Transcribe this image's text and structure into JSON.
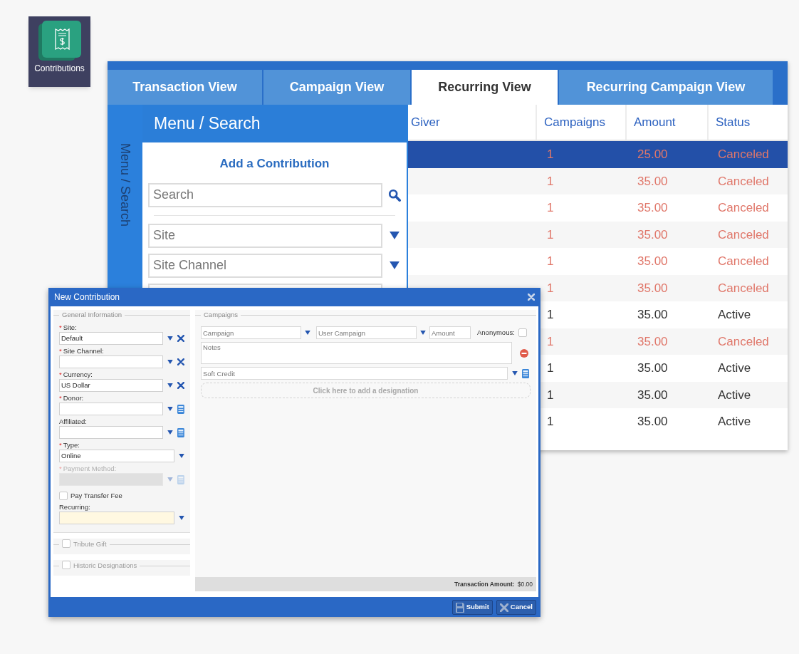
{
  "app_tile": {
    "label": "Contributions"
  },
  "main_window": {
    "tabs": [
      {
        "label": "Transaction View",
        "selected": false
      },
      {
        "label": "Campaign View",
        "selected": false
      },
      {
        "label": "Recurring View",
        "selected": true
      },
      {
        "label": "Recurring Campaign View",
        "selected": false
      }
    ],
    "side_rail": {
      "label": "Menu / Search"
    },
    "panel": {
      "title": "Menu / Search",
      "heading": "Add a Contribution",
      "search": {
        "placeholder": "Search"
      },
      "filters": [
        {
          "placeholder": "Site"
        },
        {
          "placeholder": "Site Channel"
        }
      ]
    },
    "table": {
      "columns": [
        "Giver",
        "Campaigns",
        "Amount",
        "Status"
      ],
      "rows": [
        {
          "campaigns": "1",
          "amount": "25.00",
          "status": "Canceled",
          "kind": "canceled",
          "selected": true
        },
        {
          "campaigns": "1",
          "amount": "35.00",
          "status": "Canceled",
          "kind": "canceled",
          "selected": false
        },
        {
          "campaigns": "1",
          "amount": "35.00",
          "status": "Canceled",
          "kind": "canceled",
          "selected": false
        },
        {
          "campaigns": "1",
          "amount": "35.00",
          "status": "Canceled",
          "kind": "canceled",
          "selected": false
        },
        {
          "campaigns": "1",
          "amount": "35.00",
          "status": "Canceled",
          "kind": "canceled",
          "selected": false
        },
        {
          "campaigns": "1",
          "amount": "35.00",
          "status": "Canceled",
          "kind": "canceled",
          "selected": false
        },
        {
          "campaigns": "1",
          "amount": "35.00",
          "status": "Active",
          "kind": "active",
          "selected": false
        },
        {
          "campaigns": "1",
          "amount": "35.00",
          "status": "Canceled",
          "kind": "canceled",
          "selected": false
        },
        {
          "campaigns": "1",
          "amount": "35.00",
          "status": "Active",
          "kind": "active",
          "selected": false
        },
        {
          "campaigns": "1",
          "amount": "35.00",
          "status": "Active",
          "kind": "active",
          "selected": false
        },
        {
          "campaigns": "1",
          "amount": "35.00",
          "status": "Active",
          "kind": "active",
          "selected": false
        }
      ]
    }
  },
  "dialog": {
    "title": "New Contribution",
    "general": {
      "legend": "General Information",
      "fields": [
        {
          "kind": "select",
          "required_mark": "*",
          "label": "Site:",
          "value": "Default",
          "clearable": true,
          "lookup": false,
          "disabled": false,
          "highlighted": false
        },
        {
          "kind": "select",
          "required_mark": "*",
          "label": "Site Channel:",
          "clearable": true,
          "lookup": false,
          "disabled": false,
          "highlighted": false
        },
        {
          "kind": "select",
          "required_mark": "*",
          "label": "Currency:",
          "value": "US Dollar",
          "clearable": true,
          "lookup": false,
          "disabled": false,
          "highlighted": false
        },
        {
          "kind": "select",
          "required_mark": "*",
          "label": "Donor:",
          "clearable": false,
          "lookup": true,
          "disabled": false,
          "highlighted": false
        },
        {
          "kind": "select",
          "label": "Affiliated:",
          "clearable": false,
          "lookup": true,
          "disabled": false,
          "highlighted": false
        },
        {
          "kind": "select",
          "required_mark": "*",
          "label": "Type:",
          "value": "Online",
          "clearable": false,
          "lookup": false,
          "disabled": false,
          "highlighted": false
        },
        {
          "kind": "select",
          "required_mark": "*",
          "label": "Payment Method:",
          "clearable": false,
          "lookup": true,
          "disabled": true,
          "highlighted": false
        },
        {
          "kind": "checkbox",
          "label": "Pay Transfer Fee",
          "checked": false
        },
        {
          "kind": "select",
          "label": "Recurring:",
          "clearable": false,
          "lookup": false,
          "disabled": false,
          "highlighted": true
        }
      ]
    },
    "sections": [
      {
        "label": "Tribute Gift",
        "checked": false
      },
      {
        "label": "Historic Designations",
        "checked": false
      }
    ],
    "campaigns": {
      "legend": "Campaigns",
      "campaign": {
        "placeholder": "Campaign"
      },
      "user_campaign": {
        "placeholder": "User Campaign"
      },
      "amount": {
        "placeholder": "Amount"
      },
      "anonymous": {
        "label": "Anonymous:",
        "checked": false
      },
      "notes": {
        "placeholder": "Notes"
      },
      "soft_credit": {
        "placeholder": "Soft Credit"
      },
      "add_designation": "Click here to add a designation"
    },
    "total": {
      "label": "Transaction Amount:",
      "value": "$0.00"
    },
    "buttons": [
      {
        "kind": "submit",
        "label": "Submit"
      },
      {
        "kind": "cancel",
        "label": "Cancel"
      }
    ]
  }
}
